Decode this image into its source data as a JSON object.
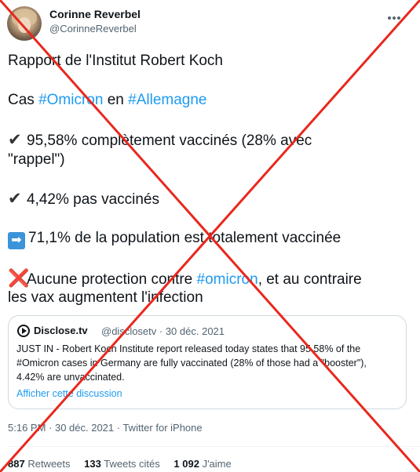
{
  "author": {
    "display_name": "Corinne Reverbel",
    "handle": "@CorinneReverbel"
  },
  "tweet": {
    "line1": "Rapport de l'Institut Robert Koch",
    "line2_prefix": "Cas ",
    "line2_tag1": "#Omicron",
    "line2_mid": " en ",
    "line2_tag2": "#Allemagne",
    "check_glyph": "✔",
    "line3a": "95,58% complètement vaccinés (28% avec",
    "line3b": "\"rappel\")",
    "line4": "4,42% pas vaccinés",
    "arrow_glyph": "➡",
    "line5": "71,1% de la population est totalement vaccinée",
    "cross_glyph": "❌",
    "line6_prefix": "Aucune protection contre ",
    "line6_tag": "#omicron",
    "line6_suffix": ", et au contraire",
    "line7": "les vax augmentent l'infection"
  },
  "quote": {
    "name": "Disclose.tv",
    "handle_date": "@disclosetv · 30 déc. 2021",
    "text_line1": "JUST IN - Robert Koch Institute report released today states that 95.58% of the",
    "text_line2": "#Omicron cases in Germany are fully vaccinated (28% of those had a \"booster\"),",
    "text_line3": "4.42% are unvaccinated.",
    "link": "Afficher cette discussion"
  },
  "meta": {
    "timestamp": "5:16 PM · 30 déc. 2021 · Twitter for iPhone"
  },
  "stats": {
    "retweets_count": "887",
    "retweets_label": "Retweets",
    "quotes_count": "133",
    "quotes_label": "Tweets cités",
    "likes_count": "1 092",
    "likes_label": "J'aime"
  },
  "colors": {
    "link_blue": "#1d9bf0",
    "cross_red": "#e8281e",
    "secondary_text": "#536471"
  },
  "icons": {
    "more": "more-options-icon",
    "quote_logo": "disclose-logo-icon"
  }
}
